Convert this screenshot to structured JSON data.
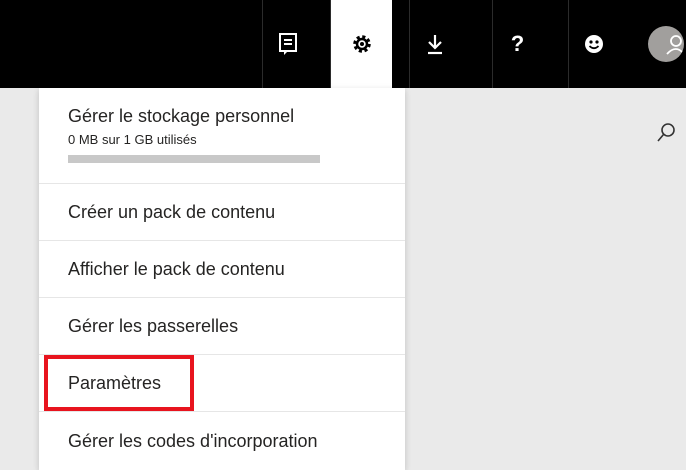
{
  "topbar": {
    "buttons": [
      {
        "icon": "feedback-icon"
      },
      {
        "icon": "gear-icon",
        "active": true
      },
      {
        "icon": "download-icon"
      },
      {
        "icon": "help-icon"
      },
      {
        "icon": "smiley-icon"
      }
    ],
    "avatar_icon": "user-avatar-icon"
  },
  "settings_menu": {
    "storage": {
      "title": "Gérer le stockage personnel",
      "usage": "0 MB sur 1 GB utilisés",
      "used_fraction": 0.0
    },
    "items": [
      {
        "label": "Créer un pack de contenu"
      },
      {
        "label": "Afficher le pack de contenu"
      },
      {
        "label": "Gérer les passerelles"
      },
      {
        "label": "Paramètres",
        "highlighted": true
      },
      {
        "label": "Gérer les codes d'incorporation"
      }
    ]
  },
  "colors": {
    "topbar_bg": "#000000",
    "highlight": "#e8141e",
    "page_bg": "#eaeaea"
  }
}
